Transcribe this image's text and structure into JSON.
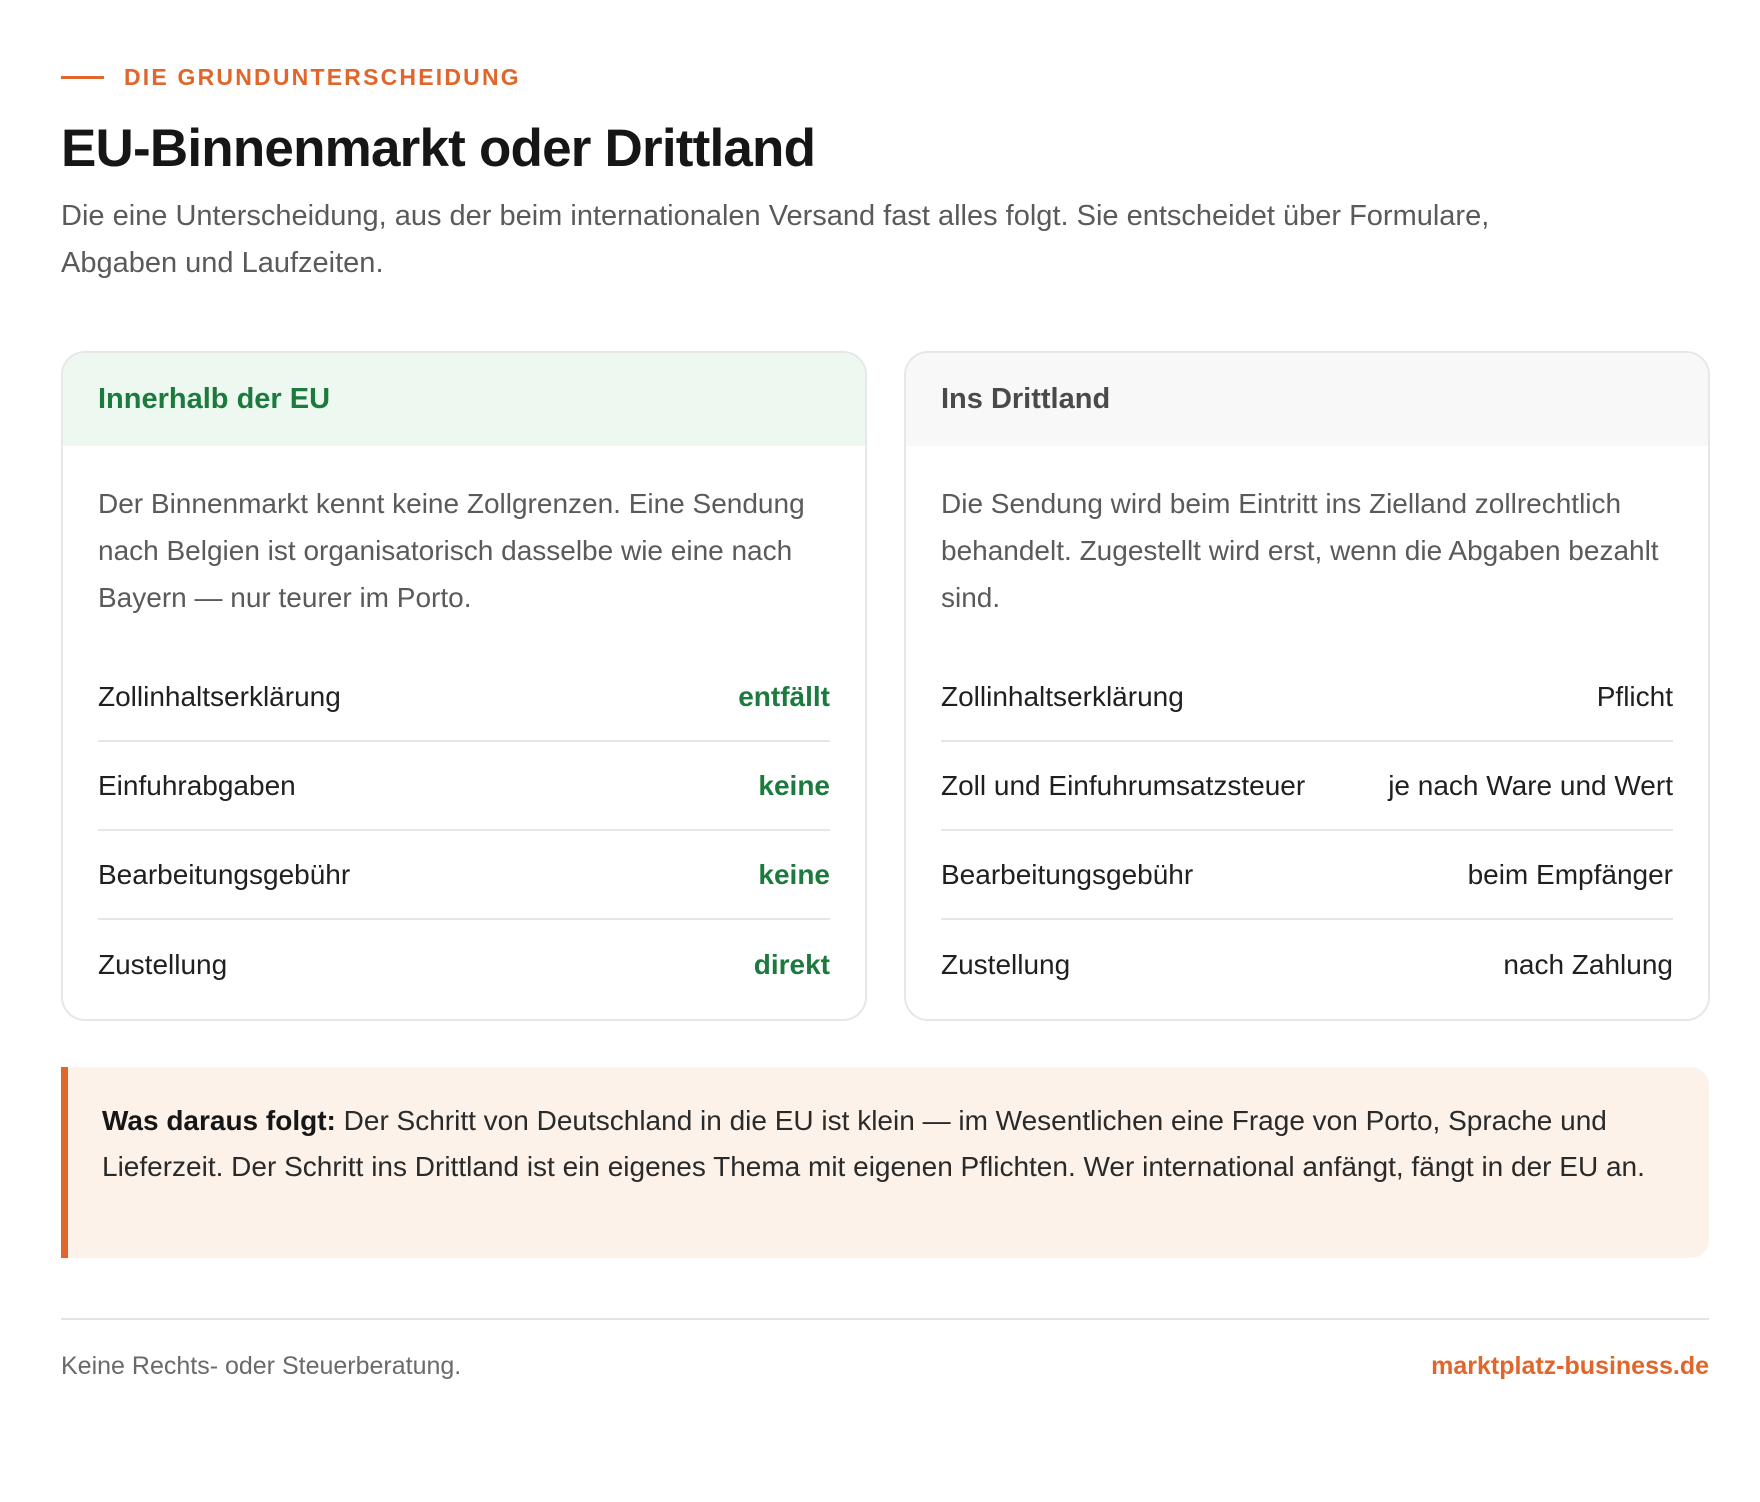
{
  "header": {
    "eyebrow": "DIE GRUNDUNTERSCHEIDUNG",
    "title": "EU-Binnenmarkt oder Drittland",
    "lead": "Die eine Unterscheidung, aus der beim internationalen Versand fast alles folgt. Sie entscheidet über Formulare, Abgaben und Laufzeiten."
  },
  "cards": {
    "eu": {
      "title": "Innerhalb der EU",
      "text": "Der Binnenmarkt kennt keine Zollgrenzen. Eine Sendung nach Belgien ist organisatorisch dasselbe wie eine nach Bayern — nur teurer im Porto.",
      "rows": [
        {
          "label": "Zollinhaltserklärung",
          "value": "entfällt"
        },
        {
          "label": "Einfuhrabgaben",
          "value": "keine"
        },
        {
          "label": "Bearbeitungsgebühr",
          "value": "keine"
        },
        {
          "label": "Zustellung",
          "value": "direkt"
        }
      ]
    },
    "third": {
      "title": "Ins Drittland",
      "text": "Die Sendung wird beim Eintritt ins Zielland zollrechtlich behandelt. Zugestellt wird erst, wenn die Abgaben bezahlt sind.",
      "rows": [
        {
          "label": "Zollinhaltserklärung",
          "value": "Pflicht"
        },
        {
          "label": "Zoll und Einfuhrumsatzsteuer",
          "value": "je nach Ware und Wert"
        },
        {
          "label": "Bearbeitungsgebühr",
          "value": "beim Empfänger"
        },
        {
          "label": "Zustellung",
          "value": "nach Zahlung"
        }
      ]
    }
  },
  "callout": {
    "lead": "Was daraus folgt:",
    "text": " Der Schritt von Deutschland in die EU ist klein — im Wesentlichen eine Frage von Porto, Sprache und Lieferzeit. Der Schritt ins Drittland ist ein eigenes Thema mit eigenen Pflichten. Wer international anfängt, fängt in der EU an."
  },
  "footer": {
    "note": "Keine Rechts- oder Steuerberatung.",
    "brand": "marktplatz-business.de"
  },
  "colors": {
    "accent": "#e0662b",
    "eu_green": "#1d7a3e",
    "eu_header_bg": "#edf9f0",
    "callout_bg": "#fdf2ea"
  }
}
